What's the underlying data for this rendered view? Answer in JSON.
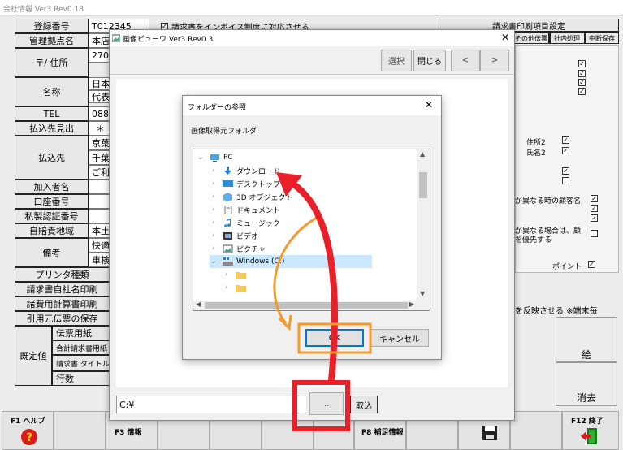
{
  "app": {
    "title": "会社情報 Ver3 Rev0.18"
  },
  "form": {
    "rows": [
      {
        "label": "登録番号",
        "value": "T012345"
      },
      {
        "label": "管理拠点名",
        "value": "本店"
      },
      {
        "label": "〒/ 住所",
        "value": "270"
      },
      {
        "label": "名称",
        "value": "日本",
        "value2": "代表"
      },
      {
        "label": "TEL",
        "value": "088-"
      },
      {
        "label": "払込先見出",
        "value": "＊"
      },
      {
        "label": "払込先",
        "value": "京葉",
        "value2": "千葉",
        "value3": "ご利"
      },
      {
        "label": "加入者名",
        "value": ""
      },
      {
        "label": "口座番号",
        "value": ""
      },
      {
        "label": "私製認証番号",
        "value": ""
      },
      {
        "label": "自賠責地域",
        "value": "本土"
      },
      {
        "label": "備考",
        "value": "快適",
        "value2": "車検"
      },
      {
        "label": "プリンタ種類",
        "value": ""
      },
      {
        "label": "請求書自社名印刷",
        "value": ""
      },
      {
        "label": "諸費用計算書印刷",
        "value": ""
      },
      {
        "label": "引用元伝票の保存",
        "value": ""
      }
    ],
    "invoice_check_label": "請求書をインボイス制度に対応させる",
    "default_label": "既定値",
    "sub_rows": [
      "伝票用紙",
      "合計請求書用紙",
      "請求書 タイトル",
      "行数"
    ]
  },
  "right_panel": {
    "header": "請求書印刷項目設定",
    "tabs": [
      "社内処理",
      "その他伝票",
      "中断保存"
    ],
    "items": [
      {
        "text": "住所2",
        "checked": true
      },
      {
        "text": "氏名2",
        "checked": true
      },
      {
        "text": "が異なる時の顧客名",
        "checked": true
      },
      {
        "text": "が異なる場合は、顧",
        "text2": "を優先する",
        "checked": false
      },
      {
        "text": "ポイント",
        "checked": true
      }
    ],
    "reflect_text": "を反映させる ※端末毎",
    "btn_picture": "絵",
    "btn_delete": "消去"
  },
  "fkeys": {
    "f1": "F1 ヘルプ",
    "f3": "F3 情報",
    "f8": "F8 補足情報",
    "f12": "F12 終了"
  },
  "viewer": {
    "title": "画像ビューワ Ver3 Rev0.3",
    "btn_select": "選択",
    "btn_close": "閉じる",
    "btn_prev": "<",
    "btn_next": ">",
    "path_value": "C:¥",
    "btn_browse": "..",
    "btn_import": "取込"
  },
  "folder_dialog": {
    "title": "フォルダーの参照",
    "label": "画像取得元フォルダ",
    "tree": [
      {
        "label": "PC",
        "icon": "pc-icon"
      },
      {
        "label": "ダウンロード",
        "icon": "download-icon"
      },
      {
        "label": "デスクトップ",
        "icon": "desktop-icon"
      },
      {
        "label": "3D オブジェクト",
        "icon": "3d-objects-icon"
      },
      {
        "label": "ドキュメント",
        "icon": "document-icon"
      },
      {
        "label": "ミュージック",
        "icon": "music-icon"
      },
      {
        "label": "ビデオ",
        "icon": "video-icon"
      },
      {
        "label": "ピクチャ",
        "icon": "picture-icon"
      },
      {
        "label": "Windows (C:)",
        "icon": "drive-icon"
      },
      {
        "label": "",
        "icon": "folder-icon"
      },
      {
        "label": "",
        "icon": "folder-icon"
      }
    ],
    "btn_ok": "OK",
    "btn_cancel": "キャンセル"
  },
  "colors": {
    "annotation_red": "#e8202a",
    "annotation_orange": "#f39a2b",
    "selection_blue": "#cce8ff",
    "ok_border": "#0078d7"
  }
}
